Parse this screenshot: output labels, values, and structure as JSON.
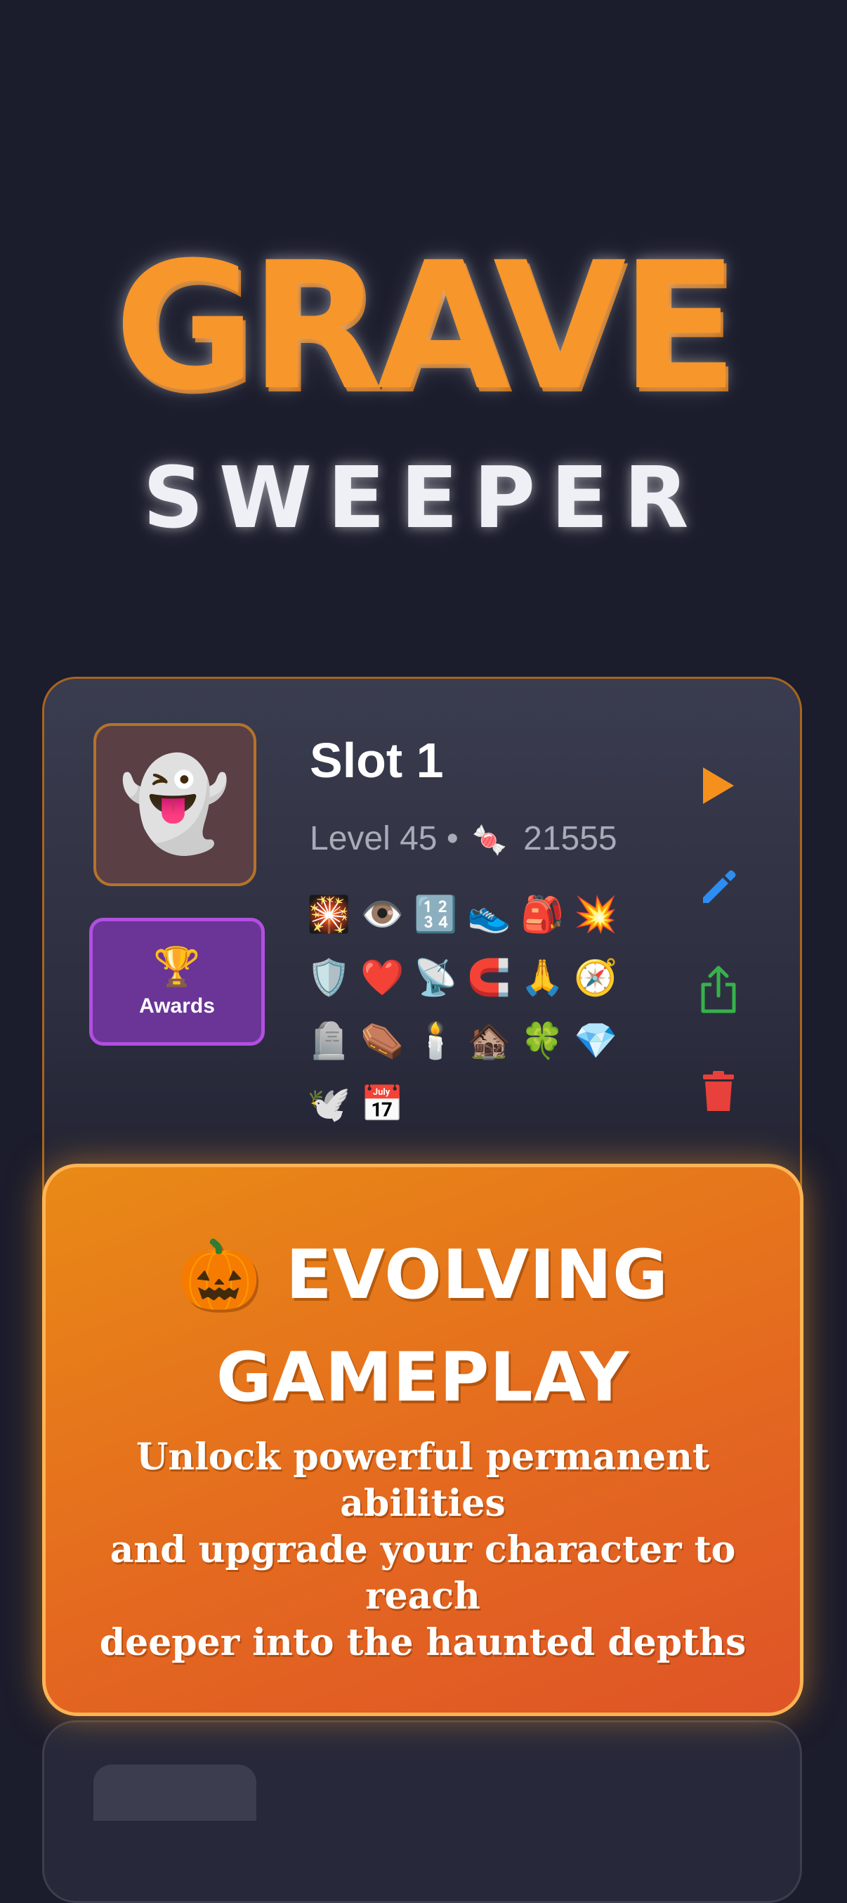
{
  "logo": {
    "title": "GRAVE",
    "subtitle": "SWEEPER"
  },
  "slot": {
    "avatar": "👻",
    "awards_icon": "🏆",
    "awards_label": "Awards",
    "name": "Slot 1",
    "level_text": "Level 45",
    "separator": "•",
    "currency_icon": "🍬",
    "currency_value": "21555",
    "abilities": [
      "🎇",
      "👁️",
      "🔢",
      "👟",
      "🎒",
      "💥",
      "🛡️",
      "❤️",
      "📡",
      "🧲",
      "🙏",
      "🧭",
      "🪦",
      "⚰️",
      "🕯️",
      "🏚️",
      "🍀",
      "💎",
      "🕊️",
      "📅"
    ],
    "actions": {
      "play_icon": "play-icon",
      "edit_icon": "pencil-icon",
      "share_icon": "share-icon",
      "delete_icon": "trash-icon"
    }
  },
  "promo": {
    "title_emoji": "🎃",
    "title": "EVOLVING GAMEPLAY",
    "body": "Unlock powerful permanent abilities\nand upgrade your character to reach\ndeeper into the haunted depths"
  },
  "colors": {
    "background": "#1b1c2c",
    "accent_orange": "#f7962a",
    "awards_purple": "#6a3597",
    "play": "#f5901c",
    "edit": "#2e8df0",
    "share": "#36b24a",
    "delete": "#e8403a"
  }
}
